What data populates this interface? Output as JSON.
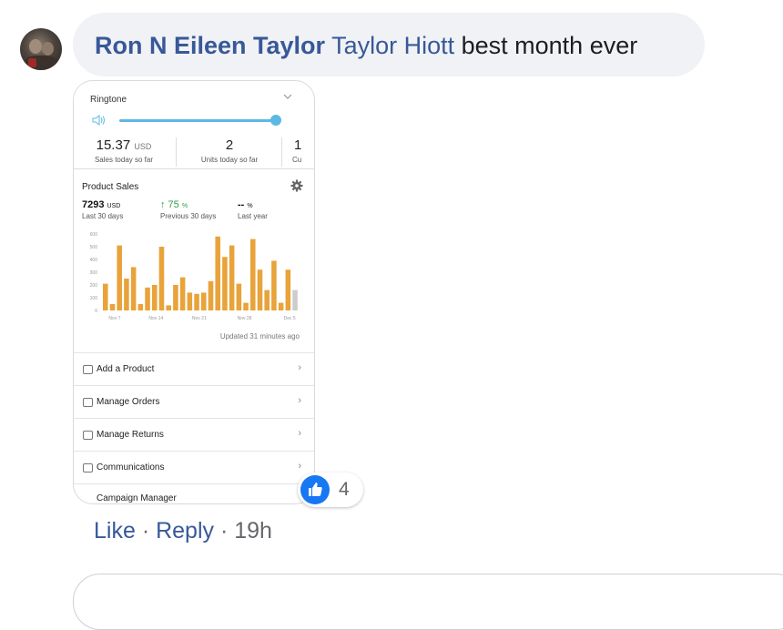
{
  "comment": {
    "author": "Ron N Eileen Taylor",
    "mention": "Taylor Hiott",
    "text": "best month ever"
  },
  "screenshot": {
    "ringtone_label": "Ringtone",
    "stats": [
      {
        "value": "15.37",
        "unit": "USD",
        "label": "Sales today so far"
      },
      {
        "value": "2",
        "unit": "",
        "label": "Units today so far"
      },
      {
        "value": "1",
        "unit": "",
        "label": "Cu"
      }
    ],
    "product_sales_title": "Product Sales",
    "metrics": {
      "last30": {
        "value": "7293",
        "unit": "USD",
        "label": "Last 30 days"
      },
      "prev30": {
        "value": "↑ 75",
        "unit": "%",
        "label": "Previous 30 days"
      },
      "lastyear": {
        "value": "--",
        "unit": "%",
        "label": "Last year"
      }
    },
    "updated": "Updated 31 minutes ago",
    "menu": [
      {
        "label": "Add a Product"
      },
      {
        "label": "Manage Orders"
      },
      {
        "label": "Manage Returns"
      },
      {
        "label": "Communications"
      },
      {
        "label": "Campaign Manager"
      }
    ]
  },
  "chart_data": {
    "type": "bar",
    "title": "Product Sales",
    "xlabel": "",
    "ylabel": "",
    "ylim": [
      0,
      600
    ],
    "yticks": [
      "600",
      "500",
      "400",
      "300",
      "200",
      "100",
      "0"
    ],
    "xticks": [
      "Nov 7",
      "Nov 14",
      "Nov 21",
      "Nov 28",
      "Dec 5"
    ],
    "values": [
      210,
      50,
      510,
      250,
      340,
      50,
      180,
      200,
      500,
      40,
      200,
      260,
      140,
      130,
      140,
      230,
      580,
      420,
      510,
      210,
      60,
      560,
      320,
      160,
      390,
      60,
      320
    ],
    "last_value_gray": 160,
    "colors": {
      "bar": "#e8a33a",
      "bar_last": "#cccccc"
    }
  },
  "reaction": {
    "count": "4",
    "type": "like-icon",
    "color": "#1877f2"
  },
  "actions": {
    "like": "Like",
    "sep1": " · ",
    "reply": "Reply",
    "sep2": " · ",
    "time": "19h"
  }
}
